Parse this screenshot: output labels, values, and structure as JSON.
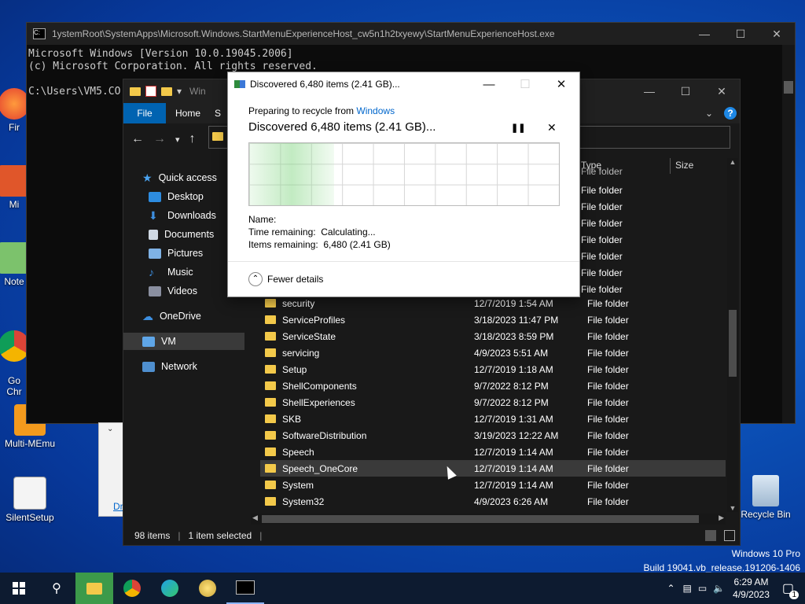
{
  "desktop": {
    "icons": [
      {
        "label": "Fir"
      },
      {
        "label": "Mi"
      },
      {
        "label": "Note"
      },
      {
        "label": "Go\nChr"
      },
      {
        "label": "Multi-MEmu"
      },
      {
        "label": "SilentSetup"
      },
      {
        "label": "Recycle Bin"
      }
    ],
    "watermark_line1": "Windows 10 Pro",
    "watermark_line2": "Build 19041.vb_release.191206-1406"
  },
  "console": {
    "title": "1ystemRoot\\SystemApps\\Microsoft.Windows.StartMenuExperienceHost_cw5n1h2txyewy\\StartMenuExperienceHost.exe",
    "lines": [
      "Microsoft Windows [Version 10.0.19045.2006]",
      "(c) Microsoft Corporation. All rights reserved.",
      "",
      "C:\\Users\\VM5.CO"
    ]
  },
  "bgwin": {
    "link": "Dr"
  },
  "explorer": {
    "title_fragment": "Win",
    "ribbon": {
      "file": "File",
      "home": "Home",
      "share_fragment": "S"
    },
    "columns": {
      "type": "Type",
      "size": "Size"
    },
    "sidebar": [
      {
        "label": "Quick access",
        "icon": "star-icon"
      },
      {
        "label": "Desktop",
        "icon": "desktop-icon"
      },
      {
        "label": "Downloads",
        "icon": "download-icon"
      },
      {
        "label": "Documents",
        "icon": "documents-icon"
      },
      {
        "label": "Pictures",
        "icon": "pictures-icon"
      },
      {
        "label": "Music",
        "icon": "music-icon"
      },
      {
        "label": "Videos",
        "icon": "videos-icon"
      },
      {
        "label": "OneDrive",
        "icon": "cloud-icon"
      },
      {
        "label": "VM",
        "icon": "pc-icon"
      },
      {
        "label": "Network",
        "icon": "network-icon"
      }
    ],
    "hidden_types": [
      "File folder",
      "File folder",
      "File folder",
      "File folder",
      "File folder",
      "File folder",
      "File folder",
      "File folder"
    ],
    "rows": [
      {
        "name": "security",
        "date": "12/7/2019 1:54 AM",
        "type": "File folder"
      },
      {
        "name": "ServiceProfiles",
        "date": "3/18/2023 11:47 PM",
        "type": "File folder"
      },
      {
        "name": "ServiceState",
        "date": "3/18/2023 8:59 PM",
        "type": "File folder"
      },
      {
        "name": "servicing",
        "date": "4/9/2023 5:51 AM",
        "type": "File folder"
      },
      {
        "name": "Setup",
        "date": "12/7/2019 1:18 AM",
        "type": "File folder"
      },
      {
        "name": "ShellComponents",
        "date": "9/7/2022 8:12 PM",
        "type": "File folder"
      },
      {
        "name": "ShellExperiences",
        "date": "9/7/2022 8:12 PM",
        "type": "File folder"
      },
      {
        "name": "SKB",
        "date": "12/7/2019 1:31 AM",
        "type": "File folder"
      },
      {
        "name": "SoftwareDistribution",
        "date": "3/19/2023 12:22 AM",
        "type": "File folder"
      },
      {
        "name": "Speech",
        "date": "12/7/2019 1:14 AM",
        "type": "File folder"
      },
      {
        "name": "Speech_OneCore",
        "date": "12/7/2019 1:14 AM",
        "type": "File folder"
      },
      {
        "name": "System",
        "date": "12/7/2019 1:14 AM",
        "type": "File folder"
      },
      {
        "name": "System32",
        "date": "4/9/2023 6:26 AM",
        "type": "File folder"
      }
    ],
    "status": {
      "items": "98 items",
      "selected": "1 item selected"
    }
  },
  "dialog": {
    "title": "Discovered 6,480 items (2.41 GB)...",
    "preparing_prefix": "Preparing to recycle from ",
    "preparing_link": "Windows",
    "heading": "Discovered 6,480 items (2.41 GB)...",
    "name_label": "Name:",
    "time_remaining": "Time remaining:  Calculating...",
    "items_remaining": "Items remaining:  6,480 (2.41 GB)",
    "fewer_details": "Fewer details"
  },
  "taskbar": {
    "time": "6:29 AM",
    "date": "4/9/2023",
    "notification_count": "1"
  },
  "colors": {
    "accent": "#0063b1",
    "folder": "#f3c94a",
    "link": "#0066cc"
  }
}
